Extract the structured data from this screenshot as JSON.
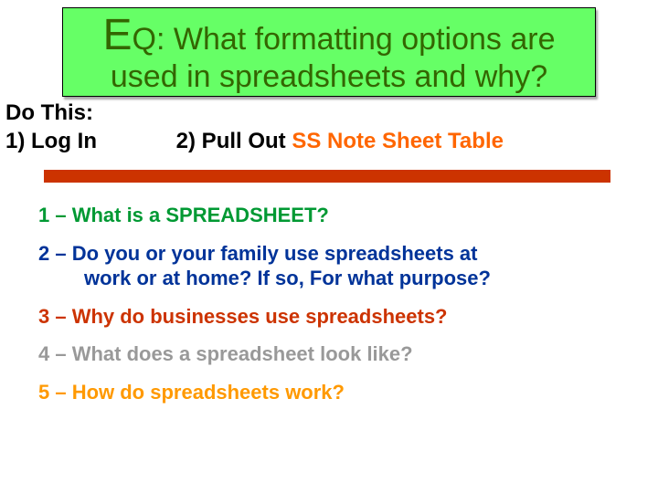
{
  "eq": {
    "big_e": "E",
    "q": "Q:",
    "line1_rest": "  What formatting options are",
    "line2": "used in spreadsheets and why?"
  },
  "instructions": {
    "heading": "Do This:",
    "step1": "1) Log In",
    "step2_prefix": "2) Pull Out ",
    "step2_highlight": "SS Note Sheet Table"
  },
  "questions": {
    "q1": "1 – What is a SPREADSHEET?",
    "q2_line1": "2 – Do you or your family use spreadsheets at",
    "q2_line2": "work or at home?   If so, For what purpose?",
    "q3": "3 – Why do businesses use spreadsheets?",
    "q4": "4 – What does a spreadsheet look like?",
    "q5": "5 – How do spreadsheets work?"
  }
}
